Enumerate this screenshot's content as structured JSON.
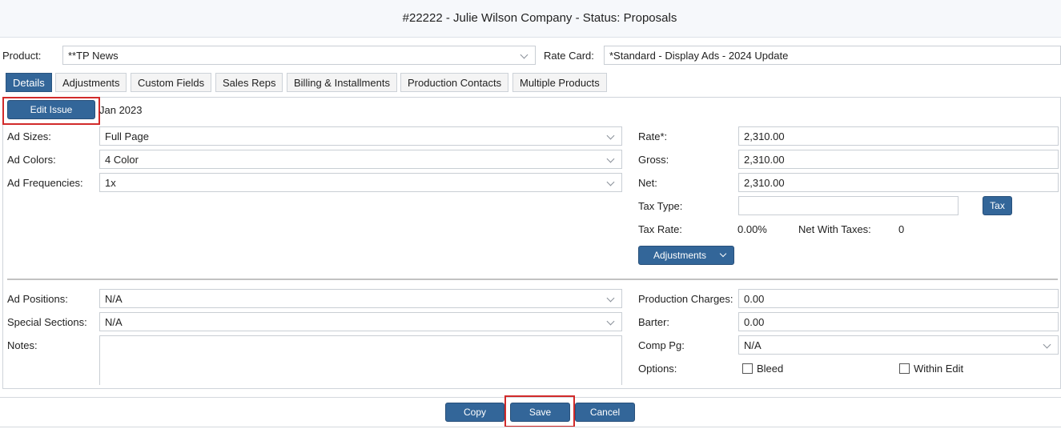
{
  "header": {
    "title": "#22222 - Julie Wilson Company - Status: Proposals"
  },
  "top": {
    "product_label": "Product:",
    "product_value": "**TP News",
    "rate_card_label": "Rate Card:",
    "rate_card_value": "*Standard - Display Ads - 2024 Update"
  },
  "tabs": [
    {
      "label": "Details"
    },
    {
      "label": "Adjustments"
    },
    {
      "label": "Custom Fields"
    },
    {
      "label": "Sales Reps"
    },
    {
      "label": "Billing & Installments"
    },
    {
      "label": "Production Contacts"
    },
    {
      "label": "Multiple Products"
    }
  ],
  "issue": {
    "edit_label": "Edit Issue",
    "value": "Jan 2023"
  },
  "left": {
    "ad_sizes_label": "Ad Sizes:",
    "ad_sizes_value": "Full Page",
    "ad_colors_label": "Ad Colors:",
    "ad_colors_value": "4 Color",
    "ad_freq_label": "Ad Frequencies:",
    "ad_freq_value": "1x",
    "ad_positions_label": "Ad Positions:",
    "ad_positions_value": "N/A",
    "special_label": "Special Sections:",
    "special_value": "N/A",
    "notes_label": "Notes:",
    "notes_value": ""
  },
  "right": {
    "rate_label": "Rate*:",
    "rate_value": "2,310.00",
    "gross_label": "Gross:",
    "gross_value": "2,310.00",
    "net_label": "Net:",
    "net_value": "2,310.00",
    "tax_type_label": "Tax Type:",
    "tax_type_value": "",
    "tax_button": "Tax",
    "tax_rate_label": "Tax Rate:",
    "tax_rate_value": "0.00%",
    "net_taxes_label": "Net With Taxes:",
    "net_taxes_value": "0",
    "adjustments_button": "Adjustments",
    "prod_charges_label": "Production Charges:",
    "prod_charges_value": "0.00",
    "barter_label": "Barter:",
    "barter_value": "0.00",
    "comp_pg_label": "Comp Pg:",
    "comp_pg_value": "N/A",
    "options_label": "Options:",
    "options": [
      {
        "label": "Bleed",
        "checked": false
      },
      {
        "label": "Within Edit",
        "checked": false
      }
    ]
  },
  "footer": {
    "copy": "Copy",
    "save": "Save",
    "cancel": "Cancel"
  },
  "colors": {
    "primary": "#336699",
    "highlight": "#d12a2a"
  }
}
